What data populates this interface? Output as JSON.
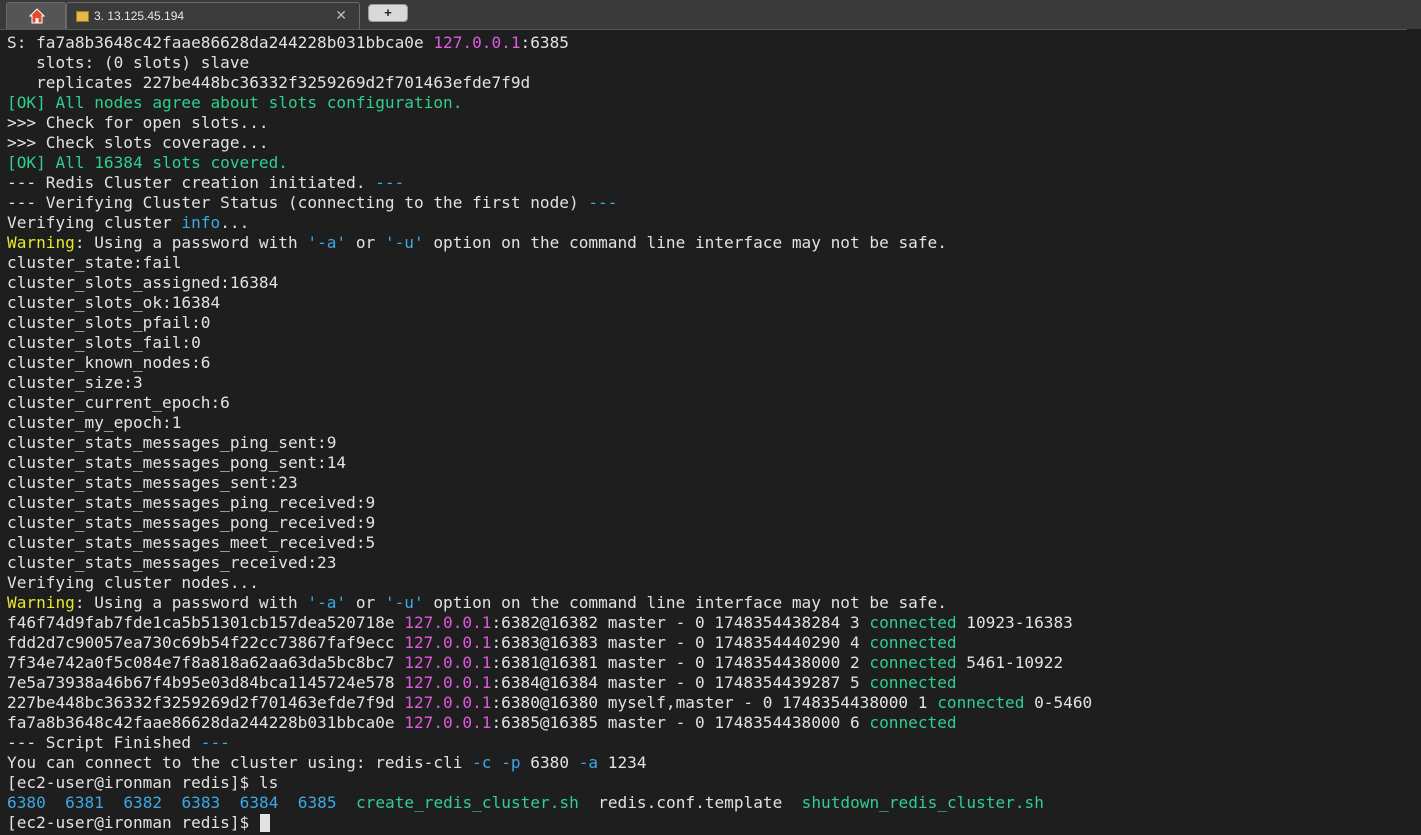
{
  "tabs": [
    {
      "name": "home",
      "icon": "house-icon"
    },
    {
      "name": "session",
      "icon": "terminal-session-icon",
      "label": "3. 13.125.45.194",
      "close": "✕"
    }
  ],
  "new_tab_label": "+",
  "colors": {
    "default": "#e2e2e2",
    "green": "#2fcf8f",
    "cyan": "#3ba9e6",
    "magenta": "#e05ae0",
    "yellow": "#e8e82a"
  },
  "terminal": {
    "lines": [
      [
        {
          "t": "S: fa7a8b3648c42faae86628da244228b031bbca0e "
        },
        {
          "t": "127.0.0.1",
          "c": "magenta"
        },
        {
          "t": ":6385"
        }
      ],
      [
        {
          "t": "   slots: (0 slots) slave"
        }
      ],
      [
        {
          "t": "   replicates 227be448bc36332f3259269d2f701463efde7f9d"
        }
      ],
      [
        {
          "t": "[OK] All nodes agree about slots configuration.",
          "c": "green"
        }
      ],
      [
        {
          "t": ">>> Check for open slots..."
        }
      ],
      [
        {
          "t": ">>> Check slots coverage..."
        }
      ],
      [
        {
          "t": "[OK] All 16384 slots covered.",
          "c": "green"
        }
      ],
      [
        {
          "t": "--- Redis Cluster creation initiated. "
        },
        {
          "t": "---",
          "c": "cyan"
        }
      ],
      [
        {
          "t": "--- Verifying Cluster Status (connecting to the first node) "
        },
        {
          "t": "---",
          "c": "cyan"
        }
      ],
      [
        {
          "t": "Verifying cluster "
        },
        {
          "t": "info",
          "c": "cyan"
        },
        {
          "t": "..."
        }
      ],
      [
        {
          "t": "Warning",
          "c": "yellow"
        },
        {
          "t": ": Using a password with "
        },
        {
          "t": "'-a'",
          "c": "cyan"
        },
        {
          "t": " or "
        },
        {
          "t": "'-u'",
          "c": "cyan"
        },
        {
          "t": " option on the command line interface may not be safe."
        }
      ],
      [
        {
          "t": "cluster_state:fail"
        }
      ],
      [
        {
          "t": "cluster_slots_assigned:16384"
        }
      ],
      [
        {
          "t": "cluster_slots_ok:16384"
        }
      ],
      [
        {
          "t": "cluster_slots_pfail:0"
        }
      ],
      [
        {
          "t": "cluster_slots_fail:0"
        }
      ],
      [
        {
          "t": "cluster_known_nodes:6"
        }
      ],
      [
        {
          "t": "cluster_size:3"
        }
      ],
      [
        {
          "t": "cluster_current_epoch:6"
        }
      ],
      [
        {
          "t": "cluster_my_epoch:1"
        }
      ],
      [
        {
          "t": "cluster_stats_messages_ping_sent:9"
        }
      ],
      [
        {
          "t": "cluster_stats_messages_pong_sent:14"
        }
      ],
      [
        {
          "t": "cluster_stats_messages_sent:23"
        }
      ],
      [
        {
          "t": "cluster_stats_messages_ping_received:9"
        }
      ],
      [
        {
          "t": "cluster_stats_messages_pong_received:9"
        }
      ],
      [
        {
          "t": "cluster_stats_messages_meet_received:5"
        }
      ],
      [
        {
          "t": "cluster_stats_messages_received:23"
        }
      ],
      [
        {
          "t": "Verifying cluster nodes..."
        }
      ],
      [
        {
          "t": "Warning",
          "c": "yellow"
        },
        {
          "t": ": Using a password with "
        },
        {
          "t": "'-a'",
          "c": "cyan"
        },
        {
          "t": " or "
        },
        {
          "t": "'-u'",
          "c": "cyan"
        },
        {
          "t": " option on the command line interface may not be safe."
        }
      ],
      [
        {
          "t": "f46f74d9fab7fde1ca5b51301cb157dea520718e "
        },
        {
          "t": "127.0.0.1",
          "c": "magenta"
        },
        {
          "t": ":6382@16382 master - 0 1748354438284 3 "
        },
        {
          "t": "connected",
          "c": "green"
        },
        {
          "t": " 10923-16383"
        }
      ],
      [
        {
          "t": "fdd2d7c90057ea730c69b54f22cc73867faf9ecc "
        },
        {
          "t": "127.0.0.1",
          "c": "magenta"
        },
        {
          "t": ":6383@16383 master - 0 1748354440290 4 "
        },
        {
          "t": "connected",
          "c": "green"
        }
      ],
      [
        {
          "t": "7f34e742a0f5c084e7f8a818a62aa63da5bc8bc7 "
        },
        {
          "t": "127.0.0.1",
          "c": "magenta"
        },
        {
          "t": ":6381@16381 master - 0 1748354438000 2 "
        },
        {
          "t": "connected",
          "c": "green"
        },
        {
          "t": " 5461-10922"
        }
      ],
      [
        {
          "t": "7e5a73938a46b67f4b95e03d84bca1145724e578 "
        },
        {
          "t": "127.0.0.1",
          "c": "magenta"
        },
        {
          "t": ":6384@16384 master - 0 1748354439287 5 "
        },
        {
          "t": "connected",
          "c": "green"
        }
      ],
      [
        {
          "t": "227be448bc36332f3259269d2f701463efde7f9d "
        },
        {
          "t": "127.0.0.1",
          "c": "magenta"
        },
        {
          "t": ":6380@16380 myself,master - 0 1748354438000 1 "
        },
        {
          "t": "connected",
          "c": "green"
        },
        {
          "t": " 0-5460"
        }
      ],
      [
        {
          "t": "fa7a8b3648c42faae86628da244228b031bbca0e "
        },
        {
          "t": "127.0.0.1",
          "c": "magenta"
        },
        {
          "t": ":6385@16385 master - 0 1748354438000 6 "
        },
        {
          "t": "connected",
          "c": "green"
        }
      ],
      [
        {
          "t": "--- Script Finished "
        },
        {
          "t": "---",
          "c": "cyan"
        }
      ],
      [
        {
          "t": "You can connect to the cluster using: redis-cli "
        },
        {
          "t": "-c",
          "c": "cyan"
        },
        {
          "t": " "
        },
        {
          "t": "-p",
          "c": "cyan"
        },
        {
          "t": " 6380 "
        },
        {
          "t": "-a",
          "c": "cyan"
        },
        {
          "t": " 1234"
        }
      ],
      [
        {
          "t": "[ec2-user@ironman redis]$ ls"
        }
      ],
      [
        {
          "t": "6380",
          "c": "cyan"
        },
        {
          "t": "  "
        },
        {
          "t": "6381",
          "c": "cyan"
        },
        {
          "t": "  "
        },
        {
          "t": "6382",
          "c": "cyan"
        },
        {
          "t": "  "
        },
        {
          "t": "6383",
          "c": "cyan"
        },
        {
          "t": "  "
        },
        {
          "t": "6384",
          "c": "cyan"
        },
        {
          "t": "  "
        },
        {
          "t": "6385",
          "c": "cyan"
        },
        {
          "t": "  "
        },
        {
          "t": "create_redis_cluster.sh",
          "c": "green"
        },
        {
          "t": "  redis.conf.template  "
        },
        {
          "t": "shutdown_redis_cluster.sh",
          "c": "green"
        }
      ],
      [
        {
          "t": "[ec2-user@ironman redis]$ "
        }
      ]
    ]
  }
}
